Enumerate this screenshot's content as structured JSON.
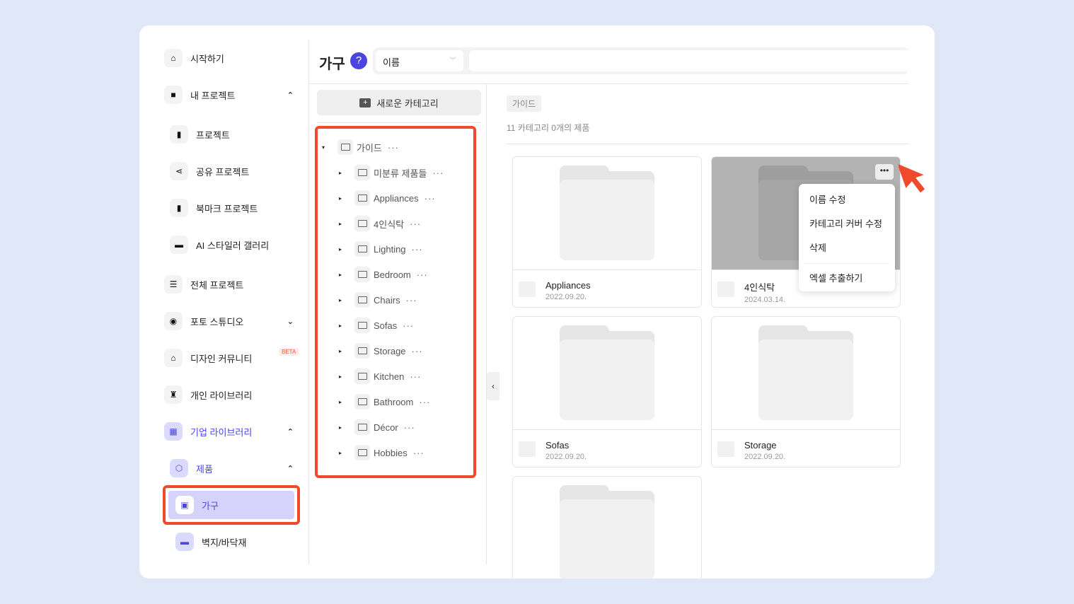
{
  "sidebar": {
    "items": [
      {
        "label": "시작하기",
        "icon": "home-icon",
        "glyph": "⌂",
        "chev": ""
      },
      {
        "label": "내 프로젝트",
        "icon": "folder-icon",
        "glyph": "■",
        "chev": "⌃"
      },
      {
        "label": "프로젝트",
        "icon": "file-icon",
        "glyph": "▮",
        "chev": "",
        "sub": 1
      },
      {
        "label": "공유 프로젝트",
        "icon": "share-icon",
        "glyph": "⋖",
        "chev": "",
        "sub": 1
      },
      {
        "label": "북마크 프로젝트",
        "icon": "bookmark-icon",
        "glyph": "▮",
        "chev": "",
        "sub": 1
      },
      {
        "label": "AI 스타일러 갤러리",
        "icon": "gallery-icon",
        "glyph": "▬",
        "chev": "",
        "sub": 1
      },
      {
        "label": "전체 프로젝트",
        "icon": "server-icon",
        "glyph": "☰",
        "chev": ""
      },
      {
        "label": "포토 스튜디오",
        "icon": "camera-icon",
        "glyph": "◉",
        "chev": "⌄"
      },
      {
        "label": "디자인 커뮤니티",
        "icon": "home-icon",
        "glyph": "⌂",
        "chev": ""
      },
      {
        "label": "개인 라이브러리",
        "icon": "chair-icon",
        "glyph": "♜",
        "chev": ""
      },
      {
        "label": "기업 라이브러리",
        "icon": "store-icon",
        "glyph": "▦",
        "chev": "⌃",
        "accent": 1
      },
      {
        "label": "제품",
        "icon": "box-icon",
        "glyph": "⬡",
        "chev": "⌃",
        "accent": 1,
        "sub": 1
      },
      {
        "label": "가구",
        "icon": "furniture-icon",
        "glyph": "▣",
        "chev": "",
        "accent": 1,
        "sub": 2
      },
      {
        "label": "벽지/바닥재",
        "icon": "bed-icon",
        "glyph": "▬",
        "chev": "",
        "sub": 2
      }
    ],
    "beta": "BETA"
  },
  "header": {
    "title": "가구",
    "help": "?",
    "sort": "이름",
    "search_placeholder": ""
  },
  "tree": {
    "new_category": "새로운 카테고리",
    "root": "가이드",
    "children": [
      "미분류 제품들",
      "Appliances",
      "4인식탁",
      "Lighting",
      "Bedroom",
      "Chairs",
      "Sofas",
      "Storage",
      "Kitchen",
      "Bathroom",
      "Décor",
      "Hobbies"
    ]
  },
  "content": {
    "breadcrumb": "가이드",
    "count": "11 카테고리 0개의 제품",
    "cards": [
      {
        "name": "Appliances",
        "date": "2022.09.20."
      },
      {
        "name": "4인식탁",
        "date": "2024.03.14."
      },
      {
        "name": "Sofas",
        "date": "2022.09.20."
      },
      {
        "name": "Storage",
        "date": "2022.09.20."
      },
      {
        "name": "",
        "date": ""
      }
    ],
    "menu": [
      "이름 수정",
      "카테고리 커버 수정",
      "삭제",
      "엑셀 추출하기"
    ]
  },
  "colors": {
    "accent": "#4b45e0",
    "highlight": "#ee4a2b",
    "selected": "#d5d3fb"
  }
}
